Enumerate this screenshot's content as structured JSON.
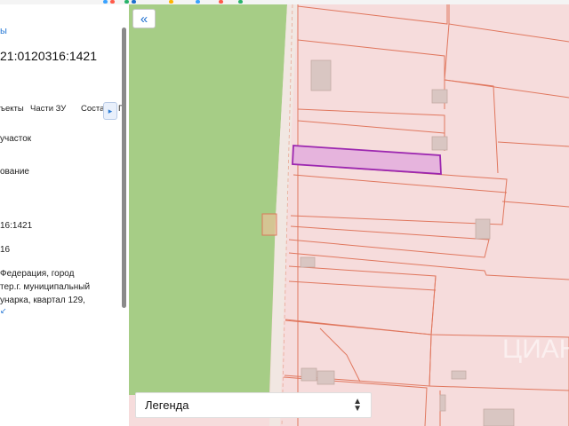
{
  "panel": {
    "breadcrumb": "ы",
    "cadastral_number": "21:0120316:1421",
    "tabs": [
      "ъекты",
      "Части ЗУ",
      "Соста",
      "Г"
    ],
    "next_tab_icon": "chevron-right-icon",
    "fields": [
      {
        "value": "участок"
      },
      {
        "value": "ование"
      },
      {
        "value": "16:1421"
      },
      {
        "value": "16"
      }
    ],
    "address_lines": [
      "Федерация, город",
      "тер.г. муниципальный",
      "унарка, квартал 129,"
    ],
    "more_link": "↙"
  },
  "map": {
    "collapse_button": "«",
    "legend_label": "Легенда",
    "watermark": "ЦИАН",
    "colors": {
      "field": "#a6cd86",
      "parcel_fill": "#f6dcdc",
      "parcel_line": "#e0775e",
      "selected_fill": "#e6b4dd",
      "selected_stroke": "#9c27b0",
      "building": "#d9c6c2"
    }
  }
}
